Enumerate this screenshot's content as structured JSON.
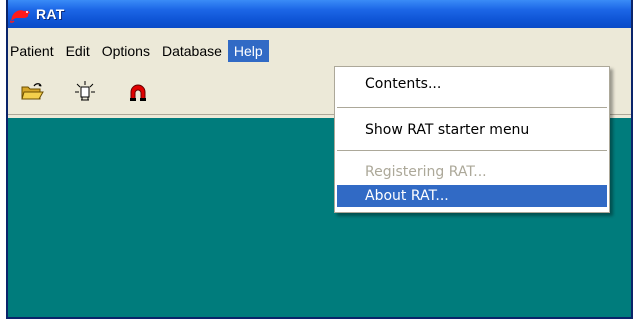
{
  "window": {
    "title": "RAT"
  },
  "menubar": {
    "items": [
      {
        "label": "Patient"
      },
      {
        "label": "Edit"
      },
      {
        "label": "Options"
      },
      {
        "label": "Database"
      },
      {
        "label": "Help"
      }
    ]
  },
  "toolbar": {
    "icons": [
      "open-folder-icon",
      "light-bulb-icon",
      "lifebuoy-icon"
    ]
  },
  "help_menu": {
    "items": [
      {
        "label": "Contents...",
        "state": "enabled"
      },
      {
        "label": "Show RAT starter menu",
        "state": "enabled"
      },
      {
        "label": "Registering RAT...",
        "state": "disabled"
      },
      {
        "label": "About RAT...",
        "state": "selected"
      }
    ]
  },
  "colors": {
    "titlebar": "#0f55d6",
    "client_area": "#007c7c",
    "menu_highlight": "#316ac5"
  }
}
